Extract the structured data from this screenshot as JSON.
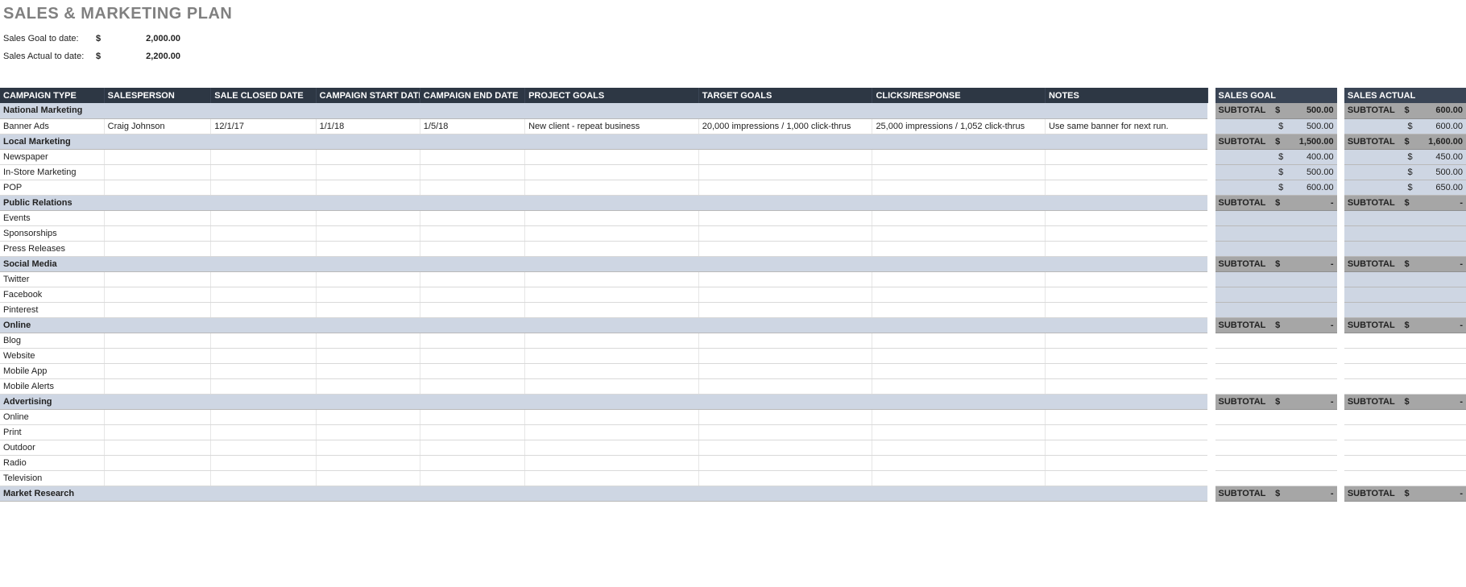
{
  "title": "SALES & MARKETING PLAN",
  "summary": {
    "goal_label": "Sales Goal to date:",
    "goal_dollar": "$",
    "goal_value": "2,000.00",
    "actual_label": "Sales Actual to date:",
    "actual_dollar": "$",
    "actual_value": "2,200.00"
  },
  "headers": {
    "campaign_type": "CAMPAIGN TYPE",
    "salesperson": "SALESPERSON",
    "sale_closed": "SALE CLOSED DATE",
    "start": "CAMPAIGN START DATE",
    "end": "CAMPAIGN END DATE",
    "project_goals": "PROJECT GOALS",
    "target_goals": "TARGET GOALS",
    "clicks": "CLICKS/RESPONSE",
    "notes": "NOTES",
    "sales_goal": "SALES GOAL",
    "sales_actual": "SALES ACTUAL"
  },
  "subtotal_label": "SUBTOTAL",
  "dollar": "$",
  "rows": [
    {
      "type": "section",
      "name": "National Marketing",
      "goal": "500.00",
      "actual": "600.00"
    },
    {
      "type": "item",
      "name": "Banner Ads",
      "salesperson": "Craig Johnson",
      "closed": "12/1/17",
      "start": "1/1/18",
      "end": "1/5/18",
      "project_goals": "New client - repeat business",
      "target_goals": "20,000 impressions / 1,000 click-thrus",
      "clicks": "25,000 impressions / 1,052 click-thrus",
      "notes": "Use same banner for next run.",
      "goal": "500.00",
      "actual": "600.00"
    },
    {
      "type": "section",
      "name": "Local Marketing",
      "goal": "1,500.00",
      "actual": "1,600.00"
    },
    {
      "type": "item",
      "name": "Newspaper",
      "goal": "400.00",
      "actual": "450.00"
    },
    {
      "type": "item",
      "name": "In-Store Marketing",
      "goal": "500.00",
      "actual": "500.00"
    },
    {
      "type": "item",
      "name": "POP",
      "goal": "600.00",
      "actual": "650.00"
    },
    {
      "type": "section",
      "name": "Public Relations",
      "goal": "-",
      "actual": "-"
    },
    {
      "type": "item",
      "name": "Events",
      "goal": null,
      "actual": null,
      "empty_sub": true
    },
    {
      "type": "item",
      "name": "Sponsorships",
      "goal": null,
      "actual": null,
      "empty_sub": true
    },
    {
      "type": "item",
      "name": "Press Releases",
      "goal": null,
      "actual": null,
      "empty_sub": true
    },
    {
      "type": "section",
      "name": "Social Media",
      "goal": "-",
      "actual": "-"
    },
    {
      "type": "item",
      "name": "Twitter",
      "goal": null,
      "actual": null,
      "empty_sub": true
    },
    {
      "type": "item",
      "name": "Facebook",
      "goal": null,
      "actual": null,
      "empty_sub": true
    },
    {
      "type": "item",
      "name": "Pinterest",
      "goal": null,
      "actual": null,
      "empty_sub": true
    },
    {
      "type": "section",
      "name": "Online",
      "goal": "-",
      "actual": "-"
    },
    {
      "type": "item",
      "name": "Blog",
      "goal": null,
      "actual": null,
      "blank_sub": true
    },
    {
      "type": "item",
      "name": "Website",
      "goal": null,
      "actual": null,
      "blank_sub": true
    },
    {
      "type": "item",
      "name": "Mobile App",
      "goal": null,
      "actual": null,
      "blank_sub": true
    },
    {
      "type": "item",
      "name": "Mobile Alerts",
      "goal": null,
      "actual": null,
      "blank_sub": true
    },
    {
      "type": "section",
      "name": "Advertising",
      "goal": "-",
      "actual": "-"
    },
    {
      "type": "item",
      "name": "Online",
      "goal": null,
      "actual": null,
      "blank_sub": true
    },
    {
      "type": "item",
      "name": "Print",
      "goal": null,
      "actual": null,
      "blank_sub": true
    },
    {
      "type": "item",
      "name": "Outdoor",
      "goal": null,
      "actual": null,
      "blank_sub": true
    },
    {
      "type": "item",
      "name": "Radio",
      "goal": null,
      "actual": null,
      "blank_sub": true
    },
    {
      "type": "item",
      "name": "Television",
      "goal": null,
      "actual": null,
      "blank_sub": true
    },
    {
      "type": "section",
      "name": "Market Research",
      "goal": "-",
      "actual": "-"
    }
  ]
}
